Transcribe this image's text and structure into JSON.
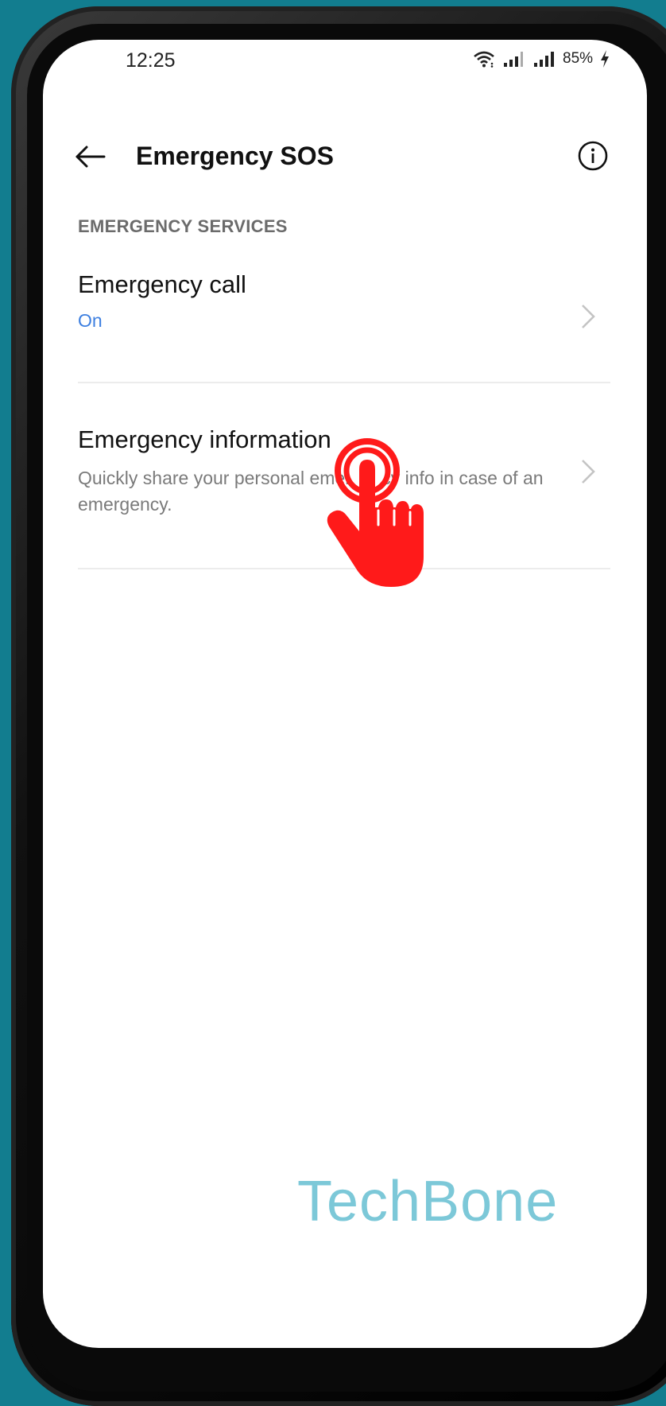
{
  "status_bar": {
    "time": "12:25",
    "battery": "85%"
  },
  "app_bar": {
    "title": "Emergency SOS",
    "back_icon": "arrow-left-icon",
    "info_icon": "info-circle-icon"
  },
  "section": {
    "header": "EMERGENCY SERVICES",
    "items": [
      {
        "title": "Emergency call",
        "subtitle": "On"
      },
      {
        "title": "Emergency information",
        "description": "Quickly share your personal emergency info in case of an emergency."
      }
    ]
  },
  "overlay": {
    "watermark": "TechBone"
  },
  "colors": {
    "background": "#127d8f",
    "accent_on": "#3d7fe0",
    "tap_hand": "#ff1a1a",
    "watermark": "#7cc8d8"
  }
}
